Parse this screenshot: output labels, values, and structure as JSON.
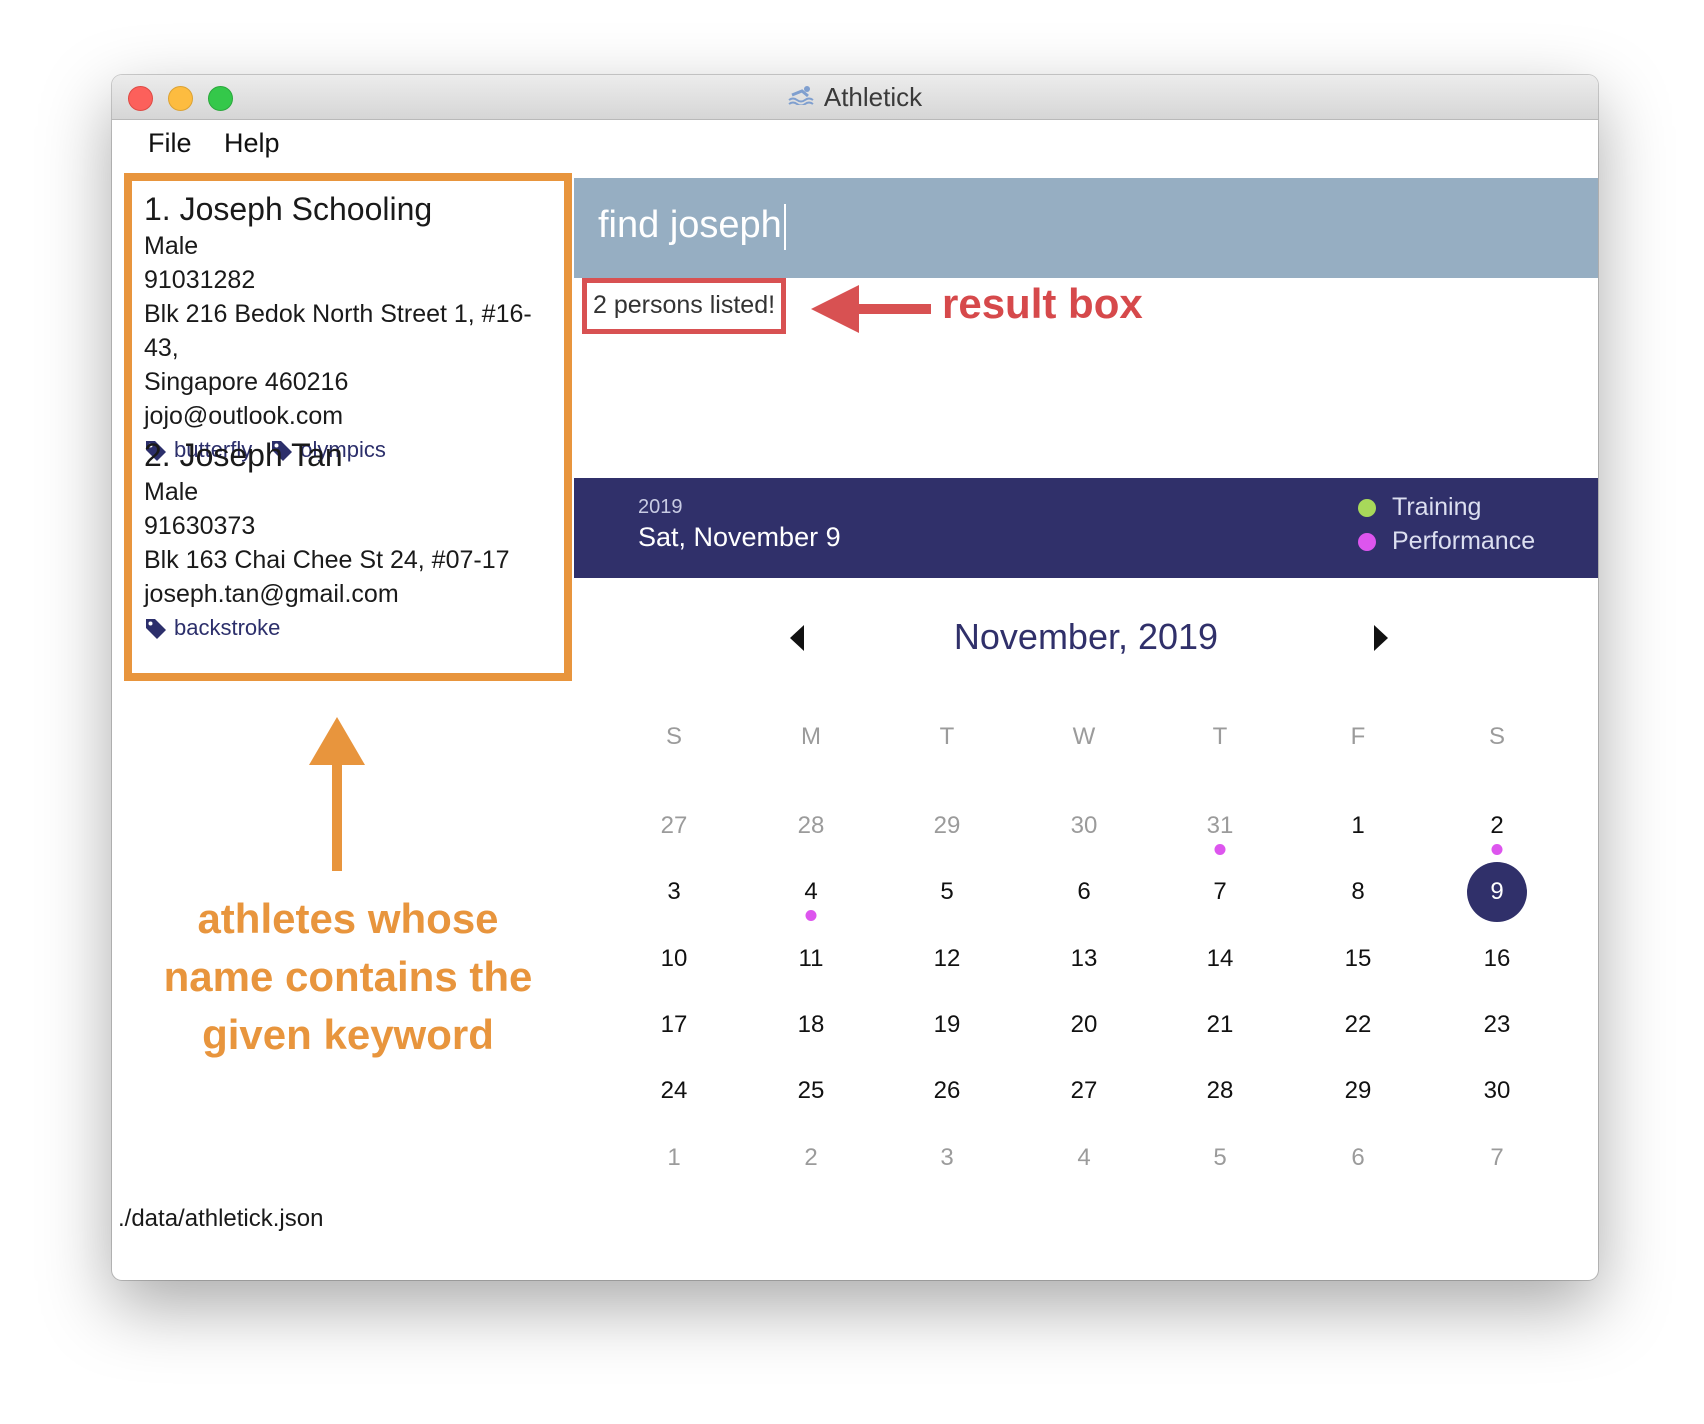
{
  "window": {
    "title": "Athletick",
    "app_icon": "athlete-swim-icon"
  },
  "menubar": {
    "file": "File",
    "help": "Help"
  },
  "persons": [
    {
      "index_name": "1.  Joseph Schooling",
      "gender": "Male",
      "phone": "91031282",
      "address_line1": "Blk 216 Bedok North Street 1, #16-43,",
      "address_line2": "Singapore 460216",
      "email": "jojo@outlook.com",
      "tags": [
        "butterfly",
        "olympics"
      ]
    },
    {
      "index_name": "2.  Joseph Tan",
      "gender": "Male",
      "phone": "91630373",
      "address_line1": "Blk 163 Chai Chee St 24, #07-17",
      "email": "joseph.tan@gmail.com",
      "tags": [
        "backstroke"
      ]
    }
  ],
  "command": {
    "value": "find joseph"
  },
  "result": {
    "text": "2 persons listed!"
  },
  "annotations": {
    "result_box": "result box",
    "left_line1": "athletes whose",
    "left_line2": "name contains the",
    "left_line3": "given keyword"
  },
  "calendar": {
    "year": "2019",
    "selected_date_text": "Sat, November 9",
    "legend": [
      {
        "label": "Training",
        "color": "#a8d95a"
      },
      {
        "label": "Performance",
        "color": "#dd55ee"
      }
    ],
    "month_label": "November, 2019",
    "weekdays": [
      "S",
      "M",
      "T",
      "W",
      "T",
      "F",
      "S"
    ],
    "weeks": [
      [
        "27",
        "28",
        "29",
        "30",
        "31",
        "1",
        "2"
      ],
      [
        "3",
        "4",
        "5",
        "6",
        "7",
        "8",
        "9"
      ],
      [
        "10",
        "11",
        "12",
        "13",
        "14",
        "15",
        "16"
      ],
      [
        "17",
        "18",
        "19",
        "20",
        "21",
        "22",
        "23"
      ],
      [
        "24",
        "25",
        "26",
        "27",
        "28",
        "29",
        "30"
      ],
      [
        "1",
        "2",
        "3",
        "4",
        "5",
        "6",
        "7"
      ]
    ],
    "selected_day": "9",
    "performance_event_days": [
      "31 Oct",
      "2 Nov",
      "4 Nov"
    ],
    "selected_color": "#30306a"
  },
  "statusbar": {
    "path": "./data/athletick.json"
  },
  "colors": {
    "command_box": "#96aec2",
    "calendar_header": "#30306a",
    "annotation_orange": "#e8953d",
    "annotation_red": "#d6494b",
    "tag_color": "#2c2f6b"
  }
}
